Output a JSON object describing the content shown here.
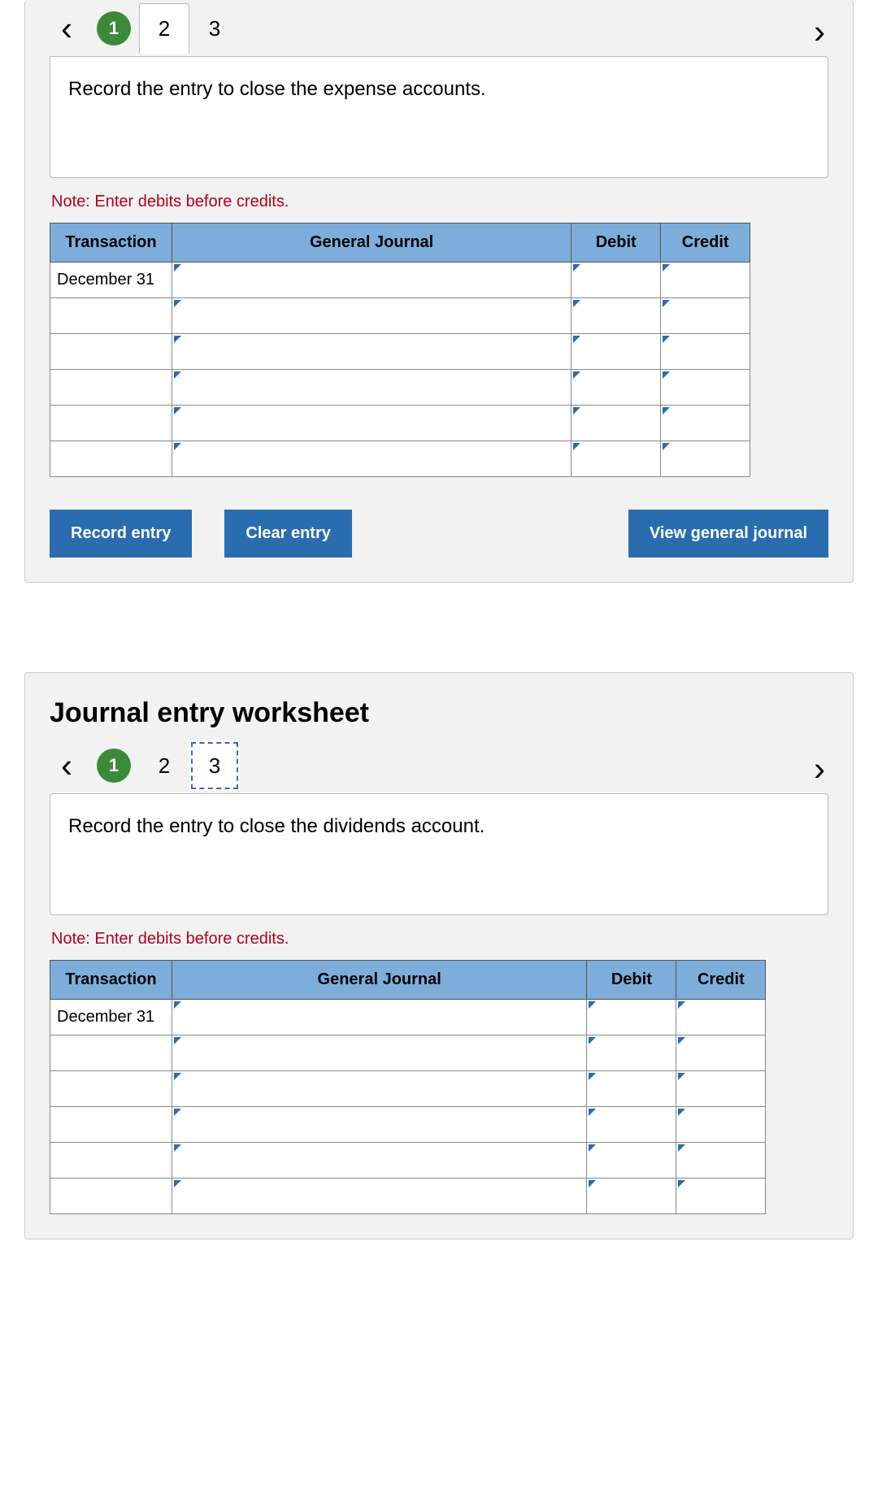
{
  "section1": {
    "steps": [
      "1",
      "2",
      "3"
    ],
    "instruction": "Record the entry to close the expense accounts.",
    "note": "Note: Enter debits before credits.",
    "headers": {
      "transaction": "Transaction",
      "general_journal": "General Journal",
      "debit": "Debit",
      "credit": "Credit"
    },
    "first_transaction": "December 31",
    "buttons": {
      "record": "Record entry",
      "clear": "Clear entry",
      "view": "View general journal"
    }
  },
  "section2": {
    "title": "Journal entry worksheet",
    "steps": [
      "1",
      "2",
      "3"
    ],
    "instruction": "Record the entry to close the dividends account.",
    "note": "Note: Enter debits before credits.",
    "headers": {
      "transaction": "Transaction",
      "general_journal": "General Journal",
      "debit": "Debit",
      "credit": "Credit"
    },
    "first_transaction": "December 31"
  }
}
